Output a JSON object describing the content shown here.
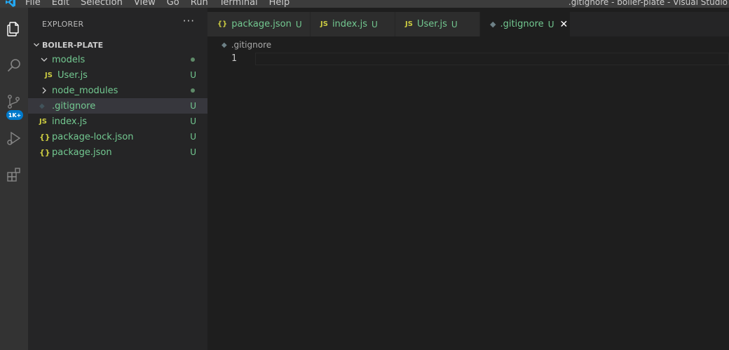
{
  "app": {
    "menus": [
      "File",
      "Edit",
      "Selection",
      "View",
      "Go",
      "Run",
      "Terminal",
      "Help"
    ],
    "window_title": ".gitignore - boiler-plate - Visual Studio"
  },
  "activity_bar": {
    "icons": [
      "explorer-icon",
      "search-icon",
      "source-control-icon",
      "run-debug-icon",
      "extensions-icon"
    ],
    "source_control_badge": "1K+",
    "accent": "#007acc"
  },
  "sidebar": {
    "header": "EXPLORER",
    "more_actions": "···",
    "section_title": "BOILER-PLATE",
    "tree": [
      {
        "name": "models",
        "kind": "folder",
        "expanded": true,
        "status": "dot"
      },
      {
        "name": "User.js",
        "kind": "js",
        "status": "U"
      },
      {
        "name": "node_modules",
        "kind": "folder",
        "expanded": false,
        "status": "dot"
      },
      {
        "name": ".gitignore",
        "kind": "git",
        "status": "U",
        "selected": true
      },
      {
        "name": "index.js",
        "kind": "js",
        "status": "U"
      },
      {
        "name": "package-lock.json",
        "kind": "json",
        "status": "U"
      },
      {
        "name": "package.json",
        "kind": "json",
        "status": "U"
      }
    ],
    "untracked_color": "#73c991"
  },
  "editor": {
    "tabs": [
      {
        "icon": "{}",
        "label": "package.json",
        "status": "U",
        "active": false
      },
      {
        "icon": "JS",
        "label": "index.js",
        "status": "U",
        "active": false
      },
      {
        "icon": "JS",
        "label": "User.js",
        "status": "U",
        "active": false
      },
      {
        "icon": "◆",
        "label": ".gitignore",
        "status": "U",
        "active": true,
        "close": "✕"
      }
    ],
    "breadcrumb": ".gitignore",
    "breadcrumb_icon": "◆",
    "line_numbers": [
      "1"
    ]
  }
}
